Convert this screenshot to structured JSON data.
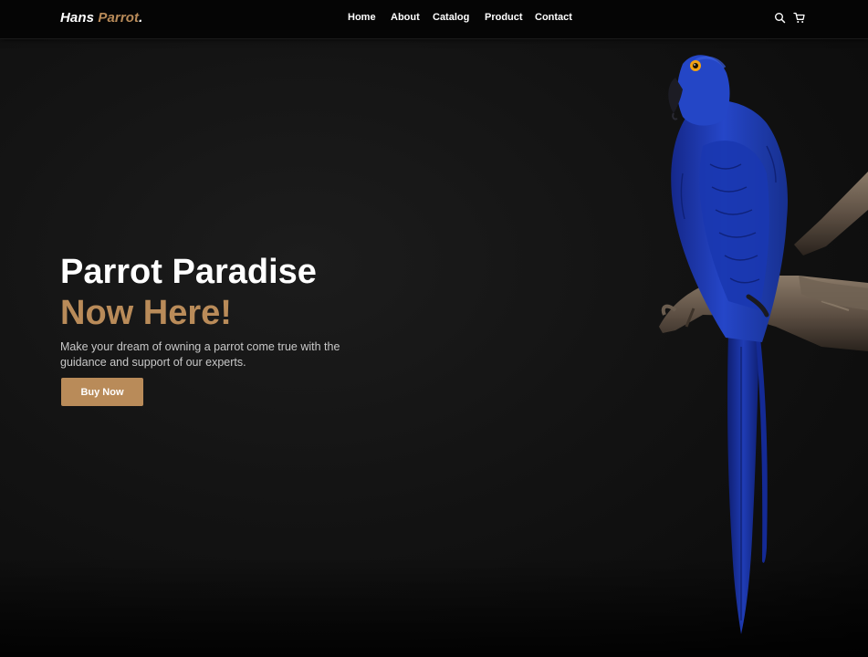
{
  "brand": {
    "name_part1": "Hans",
    "name_part2": "Parrot",
    "name_dot": "."
  },
  "nav": {
    "items": [
      "Home",
      "About",
      "Catalog",
      "Product",
      "Contact"
    ]
  },
  "header_icons": [
    "search-icon",
    "cart-icon"
  ],
  "hero": {
    "title_line1": "Parrot Paradise",
    "title_line2": "Now Here!",
    "description": "Make your dream of owning a parrot come true with the guidance and support of our experts.",
    "button_label": "Buy Now"
  },
  "colors": {
    "accent": "#b98b59",
    "background": "#111111",
    "navbar": "#050505",
    "parrot_blue": "#1f3fbf"
  }
}
